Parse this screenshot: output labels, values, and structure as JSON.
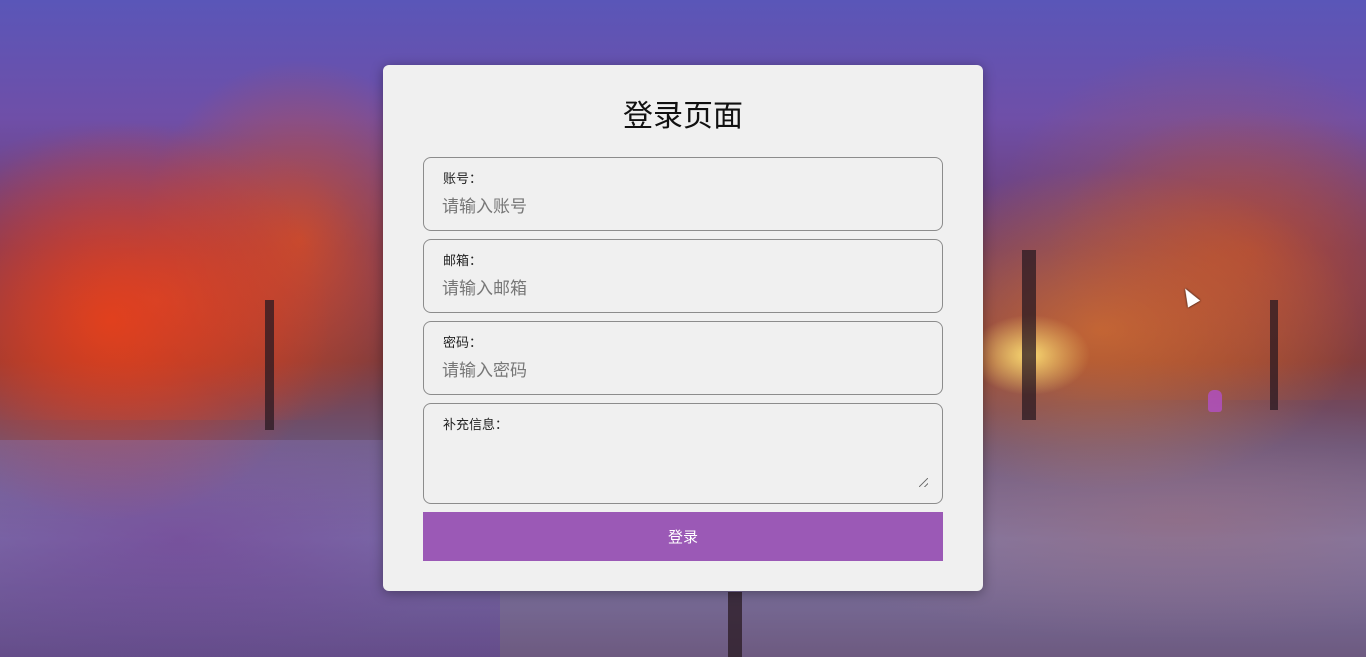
{
  "page": {
    "title": "登录页面"
  },
  "form": {
    "account": {
      "label": "账号：",
      "placeholder": "请输入账号",
      "value": ""
    },
    "email": {
      "label": "邮箱：",
      "placeholder": "请输入邮箱",
      "value": ""
    },
    "password": {
      "label": "密码：",
      "placeholder": "请输入密码",
      "value": ""
    },
    "extra": {
      "label": "补充信息：",
      "value": ""
    },
    "submit_label": "登录"
  },
  "colors": {
    "accent": "#9b59b6",
    "card_background": "#f0f0f0",
    "field_border": "#8c8c8c"
  },
  "icons": {
    "cursor": "arrow-cursor-icon",
    "textarea_resize": "resize-grip-icon"
  }
}
